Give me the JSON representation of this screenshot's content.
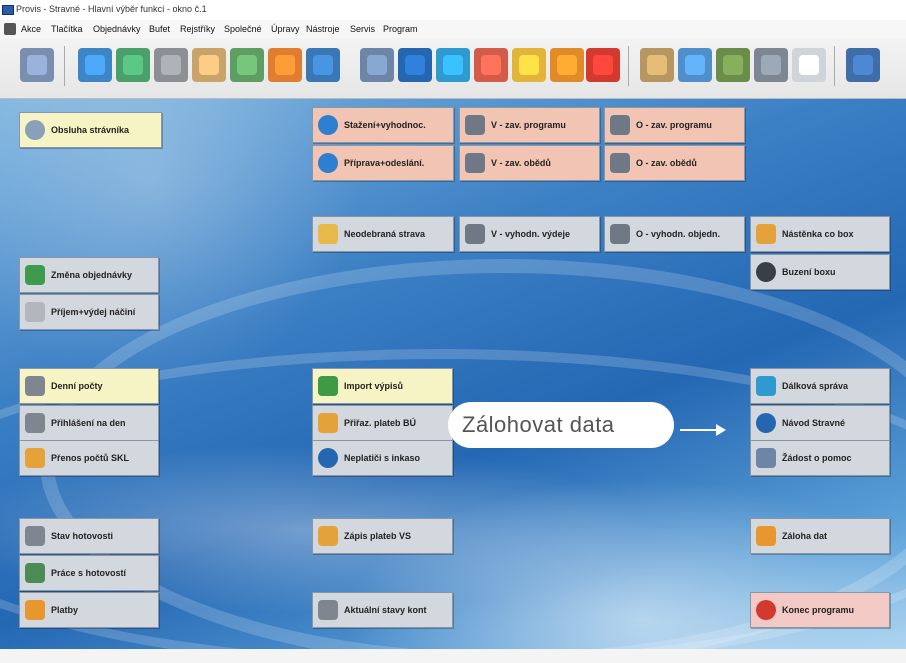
{
  "window": {
    "title": "Provis - Stravné - Hlavní výběr funkcí - okno č.1"
  },
  "menu": [
    "Akce",
    "Tlačítka",
    "Objednávky",
    "Bufet",
    "Rejstříky",
    "Společné",
    "Úpravy",
    "Nástroje",
    "Servis",
    "Program"
  ],
  "buttons": {
    "obsluha": "Obsluha strávníka",
    "stazeni": "Stažení+vyhodnoc.",
    "v_zav_programu": "V - zav. programu",
    "o_zav_programu": "O - zav. programu",
    "priprava": "Příprava+odeslání.",
    "v_zav_obedu": "V - zav. obědů",
    "o_zav_obedu": "O - zav. obědů",
    "neodebrana": "Neodebraná strava",
    "v_vyhodn": "V - vyhodn. výdeje",
    "o_vyhodn": "O - vyhodn. objedn.",
    "nastenka": "Nástěnka co box",
    "zmena": "Změna objednávky",
    "buzeni": "Buzení boxu",
    "prijem": "Příjem+výdej náčiní",
    "denni": "Denní počty",
    "import": "Import výpisů",
    "dalkova": "Dálková správa",
    "prihlaseni": "Přihlášení na den",
    "priraz": "Přiřaz. plateb BÚ",
    "navod": "Návod Stravné",
    "prenos": "Přenos počtů SKL",
    "neplatici": "Neplatiči s inkaso",
    "zadost": "Žádost o pomoc",
    "stav": "Stav hotovosti",
    "zapis": "Zápis plateb VS",
    "zaloha": "Záloha dat",
    "prace": "Práce s hotovostí",
    "platby": "Platby",
    "aktualni": "Aktuální stavy kont",
    "konec": "Konec programu"
  },
  "callout": {
    "text": "Zálohovat data"
  }
}
